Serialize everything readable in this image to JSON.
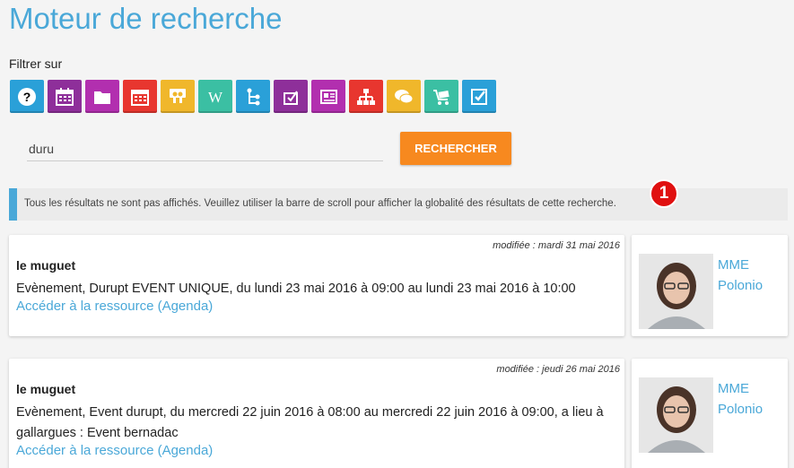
{
  "page": {
    "title": "Moteur de recherche"
  },
  "filters": {
    "label": "Filtrer sur",
    "buttons": [
      {
        "name": "help-icon",
        "color": "#2aa0d8"
      },
      {
        "name": "calendar-icon",
        "color": "#8e2f9a"
      },
      {
        "name": "folder-icon",
        "color": "#b22faf"
      },
      {
        "name": "agenda-icon",
        "color": "#e8362f"
      },
      {
        "name": "slideshare-icon",
        "color": "#f0b72b"
      },
      {
        "name": "wikipedia-icon",
        "color": "#3bbfa3"
      },
      {
        "name": "tree-icon",
        "color": "#2aa0d8"
      },
      {
        "name": "tools-icon",
        "color": "#8e2f9a"
      },
      {
        "name": "newspaper-icon",
        "color": "#b22faf"
      },
      {
        "name": "sitemap-icon",
        "color": "#e8362f"
      },
      {
        "name": "comments-icon",
        "color": "#f0b72b"
      },
      {
        "name": "cart-icon",
        "color": "#3bbfa3"
      },
      {
        "name": "checkbox-icon",
        "color": "#2aa0d8"
      }
    ]
  },
  "search": {
    "value": "duru",
    "button_label": "RECHERCHER"
  },
  "notice": {
    "text": "Tous les résultats ne sont pas affichés. Veuillez utiliser la barre de scroll pour afficher la globalité des résultats de cette recherche.",
    "badge": "1"
  },
  "results": [
    {
      "date": "modifiée : mardi 31 mai 2016",
      "title": "le muguet",
      "description": "Evènement, Durupt EVENT UNIQUE, du lundi 23 mai 2016 à 09:00 au lundi 23 mai 2016 à 10:00",
      "link": "Accéder à la ressource (Agenda)",
      "author_line1": "MME",
      "author_line2": "Polonio"
    },
    {
      "date": "modifiée : jeudi 26 mai 2016",
      "title": "le muguet",
      "description": "Evènement, Event durupt, du mercredi 22 juin 2016 à 08:00 au mercredi 22 juin 2016 à 09:00, a lieu à gallargues : Event bernadac",
      "link": "Accéder à la ressource (Agenda)",
      "author_line1": "MME",
      "author_line2": "Polonio"
    }
  ]
}
